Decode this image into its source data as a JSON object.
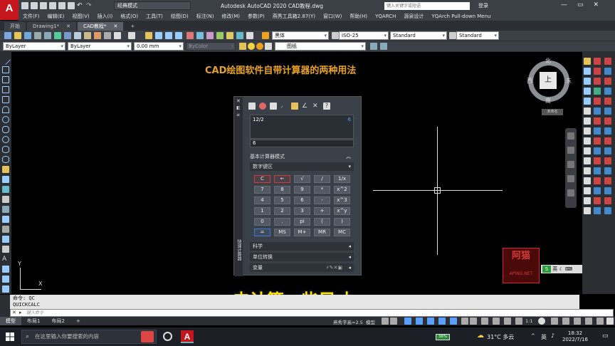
{
  "window": {
    "logo_letter": "A",
    "workspace": "经典模式",
    "title": "Autodesk AutoCAD 2020   CAD教程.dwg",
    "search_placeholder": "键入关键字或短语",
    "login": "登录",
    "controls": [
      "—",
      "▭",
      "✕"
    ]
  },
  "menu": [
    "文件(F)",
    "编辑(E)",
    "视图(V)",
    "插入(I)",
    "格式(O)",
    "工具(T)",
    "绘图(D)",
    "标注(N)",
    "修改(M)",
    "参数(P)",
    "燕秀工具箱2.87(Y)",
    "窗口(W)",
    "帮助(H)",
    "YQARCH",
    "源泉设计",
    "YQArch Pull-down Menu"
  ],
  "tabs": [
    {
      "label": "开始"
    },
    {
      "label": "Drawing1*",
      "close": "✕"
    },
    {
      "label": "CAD教程*",
      "close": "✕"
    }
  ],
  "tab_add": "+",
  "toolbar1": {
    "font_style": "黑体",
    "dim_style": "ISO-25",
    "table_style": "Standard",
    "ml_style": "Standard"
  },
  "toolbar2": {
    "layer": "ByLayer",
    "linetype": "ByLayer",
    "lineweight": "0.00 mm",
    "color": "ByColor",
    "layer_name": "图纸"
  },
  "canvas": {
    "title": "CAD绘图软件自带计算器的两种用法",
    "subtitle": "去计算一些尺寸",
    "ucs_y": "Y",
    "ucs_x": "X"
  },
  "viewcube": {
    "north": "北",
    "south": "南",
    "east": "东",
    "west": "西",
    "top": "上",
    "wcs": "未命名"
  },
  "calculator": {
    "side_label": "快速计算器",
    "expression": "12/2",
    "result": "6",
    "input": "6",
    "mode": "基本计算器模式",
    "keypad_header": "数字键区",
    "keys": [
      [
        "C",
        "←",
        "√",
        "/",
        "1/x"
      ],
      [
        "7",
        "8",
        "9",
        "*",
        "x^2"
      ],
      [
        "4",
        "5",
        "6",
        "-",
        "x^3"
      ],
      [
        "1",
        "2",
        "3",
        "+",
        "x^y"
      ],
      [
        "0",
        ".",
        "pi",
        "(",
        ")"
      ],
      [
        "=",
        "MS",
        "M+",
        "MR",
        "MC"
      ]
    ],
    "science": "科学",
    "units": "单位转换",
    "variables": "变量"
  },
  "stamp": {
    "line1": "阿",
    "line2": "猫",
    "site": "APING.NET"
  },
  "ime": {
    "label": "英"
  },
  "command": {
    "history": [
      "命令: QC",
      "QUICKCALC"
    ],
    "placeholder": "键入命令"
  },
  "layout_tabs": [
    "模型",
    "布局1",
    "布局2"
  ],
  "layout_add": "+",
  "status": {
    "text_height": "燕秀字高=2.5",
    "model_label": "模型",
    "scale": "1:1"
  },
  "taskbar": {
    "search": "在这里输入你要搜索的内容",
    "battery": "36%",
    "weather": "31°C 多云",
    "lang": "英",
    "time": "18:32",
    "date": "2022/7/16"
  },
  "colors": {
    "accent_red": "#c4161c",
    "title_orange": "#e8a22a",
    "subtitle_yellow": "#ffe400",
    "ribbon": "#3b3f46"
  }
}
